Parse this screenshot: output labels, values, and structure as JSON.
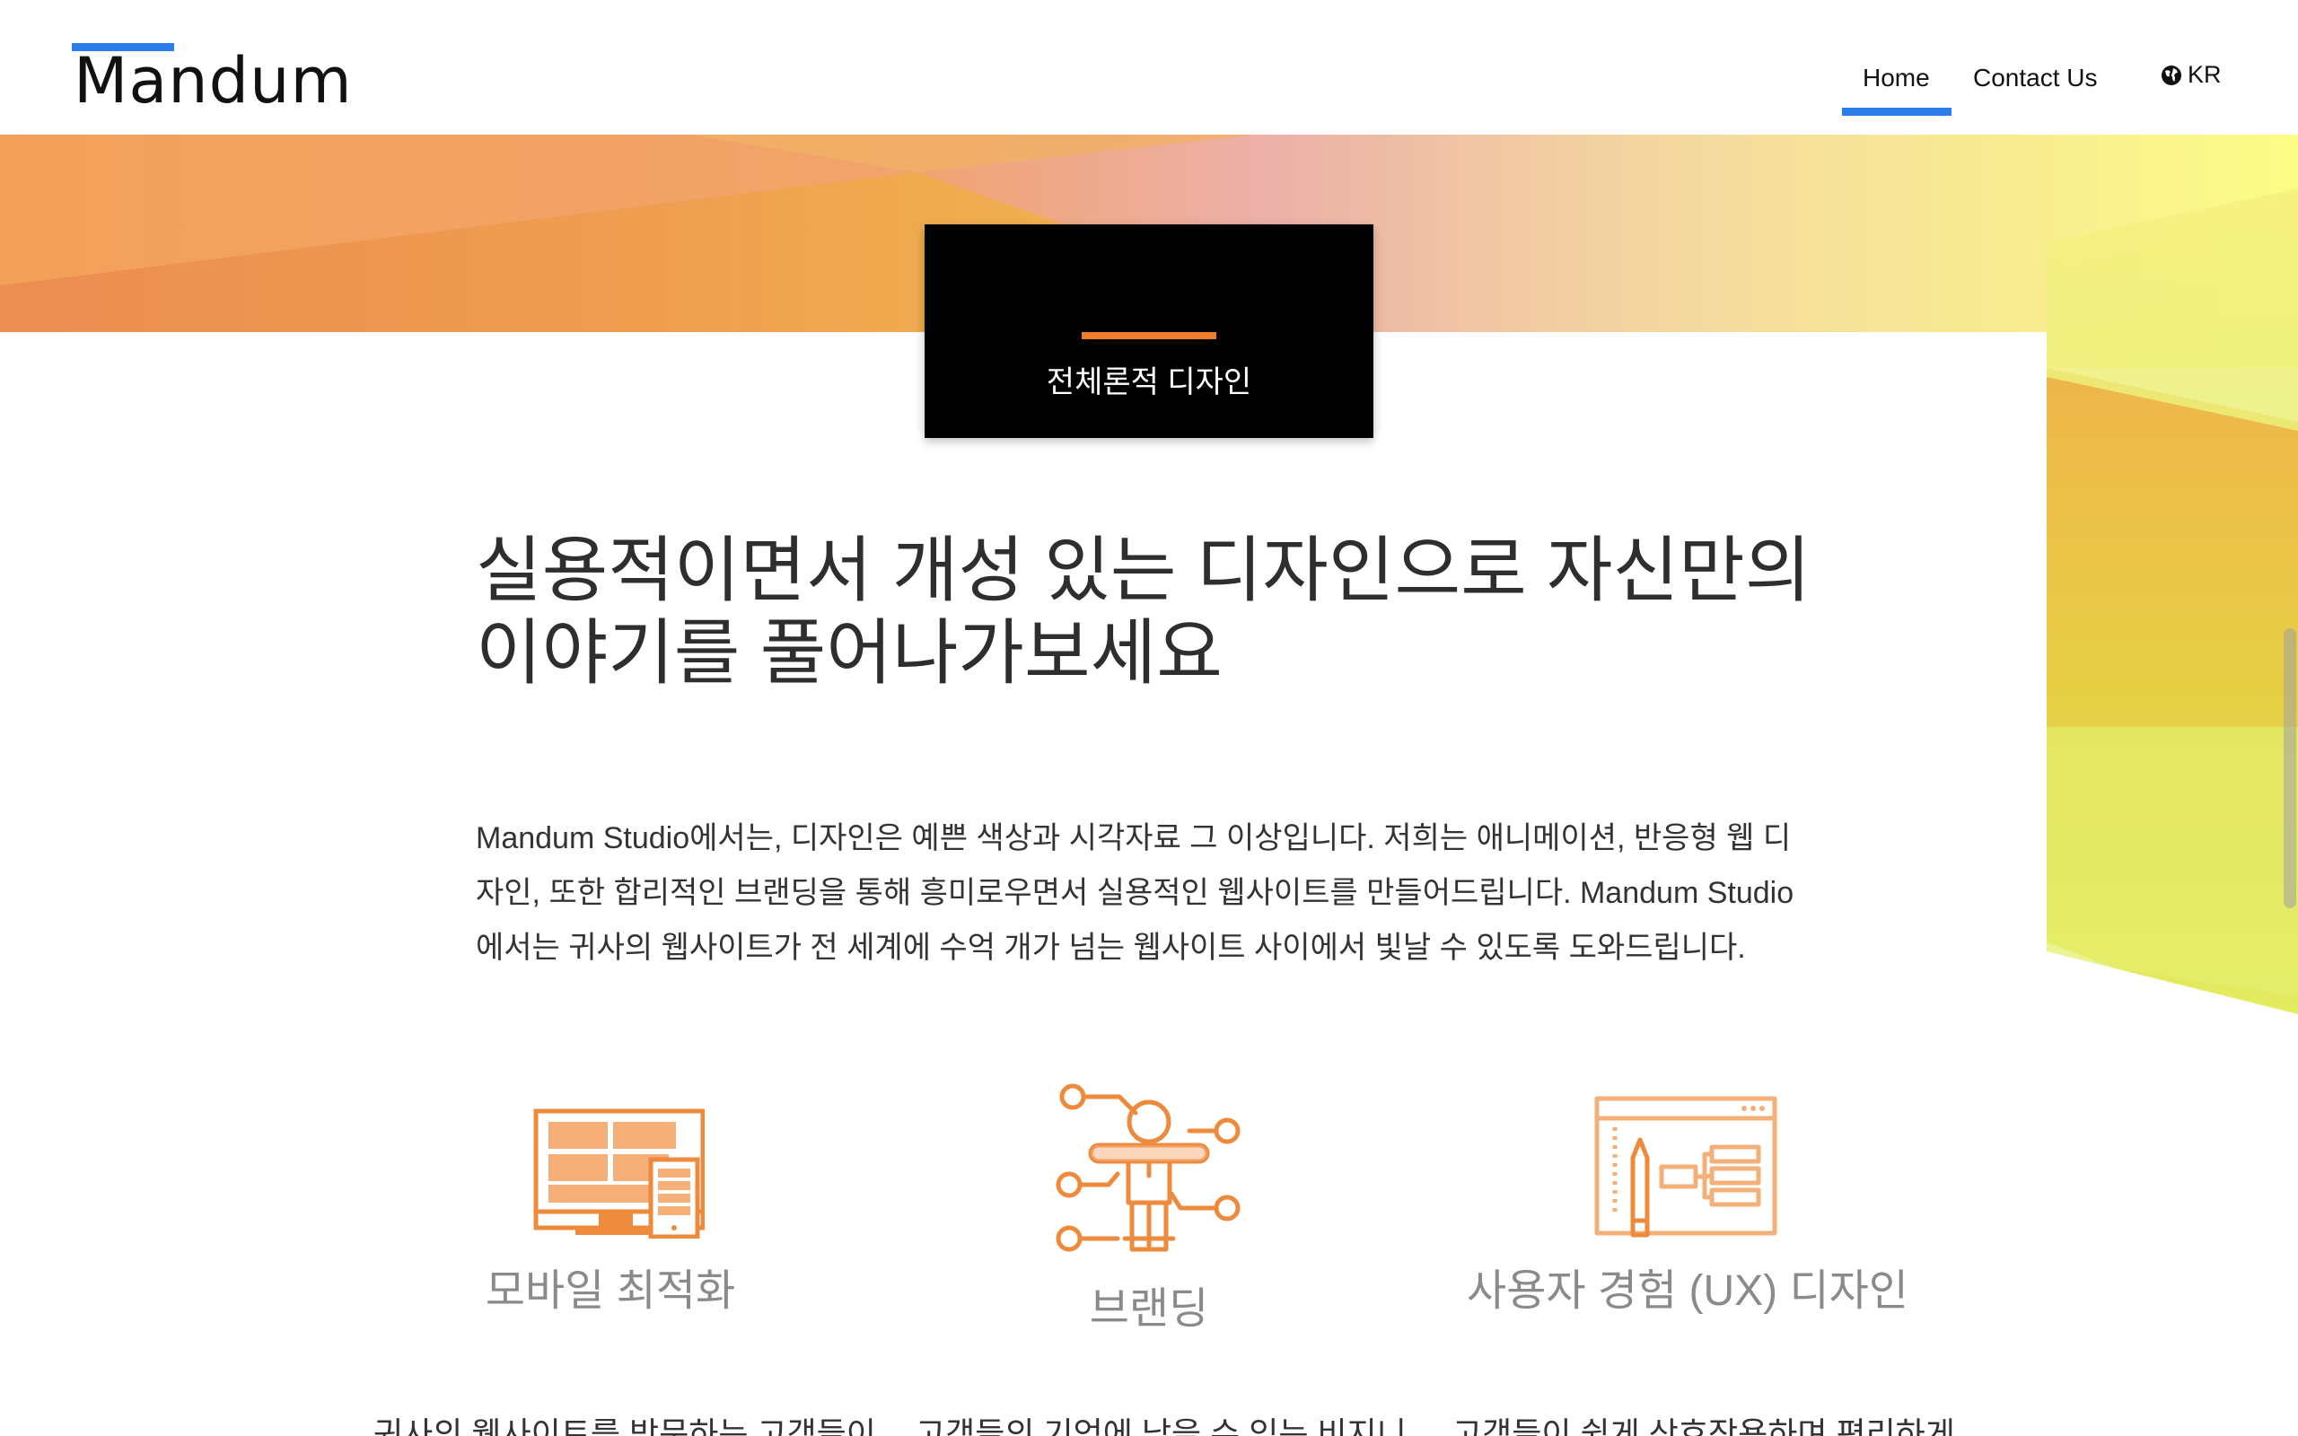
{
  "header": {
    "logo": "Mandum",
    "nav": {
      "home": "Home",
      "contact": "Contact Us"
    },
    "language": "KR"
  },
  "badge": {
    "label": "전체론적 디자인"
  },
  "main": {
    "headline_line1": "실용적이면서 개성 있는 디자인으로 자신만의",
    "headline_line2": "이야기를 풀어나가보세요",
    "intro_line1": "Mandum Studio에서는, 디자인은 예쁜 색상과 시각자료 그 이상입니다. 저희는 애니메이션, 반응형 웹 디",
    "intro_line2": "자인, 또한 합리적인 브랜딩을 통해 흥미로우면서 실용적인 웹사이트를 만들어드립니다. Mandum Studio",
    "intro_line3": "에서는 귀사의 웹사이트가 전 세계에 수억 개가 넘는 웹사이트 사이에서 빛날 수 있도록 도와드립니다."
  },
  "features": [
    {
      "icon": "responsive-devices-icon",
      "title": "모바일 최적화",
      "desc": "귀사의 웹사이트를 방문하는 고객들이"
    },
    {
      "icon": "branding-figure-icon",
      "title": "브랜딩",
      "desc": "고객들의 기억에 남을 수 있는 비지니"
    },
    {
      "icon": "ux-wireframe-icon",
      "title": "사용자 경험 (UX) 디자인",
      "desc": "고객들이 쉽게 상호작용하며 편리하게"
    }
  ],
  "colors": {
    "accent": "#2b7de9",
    "orange": "#f07f2c",
    "icon_orange": "#ee8a3c",
    "icon_light": "#f5b07a"
  }
}
